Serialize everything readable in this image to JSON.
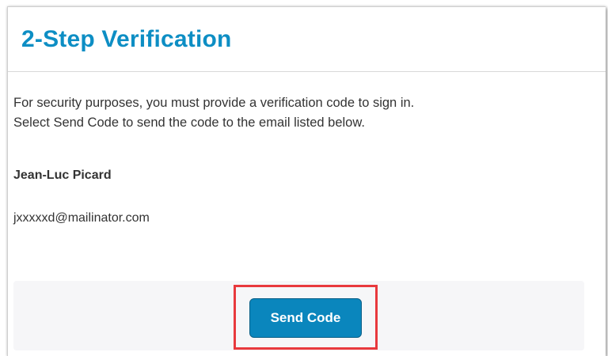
{
  "dialog": {
    "title": "2-Step Verification",
    "message_line1": "For security purposes, you must provide a verification code to sign in.",
    "message_line2": "Select Send Code to send the code to the email listed below.",
    "user_name": "Jean-Luc Picard",
    "user_email": "jxxxxxd@mailinator.com",
    "send_button_label": "Send Code"
  },
  "colors": {
    "title": "#0d8ec4",
    "button": "#0a86bd",
    "highlight": "#e8393d",
    "footer_bg": "#f6f6f8"
  }
}
